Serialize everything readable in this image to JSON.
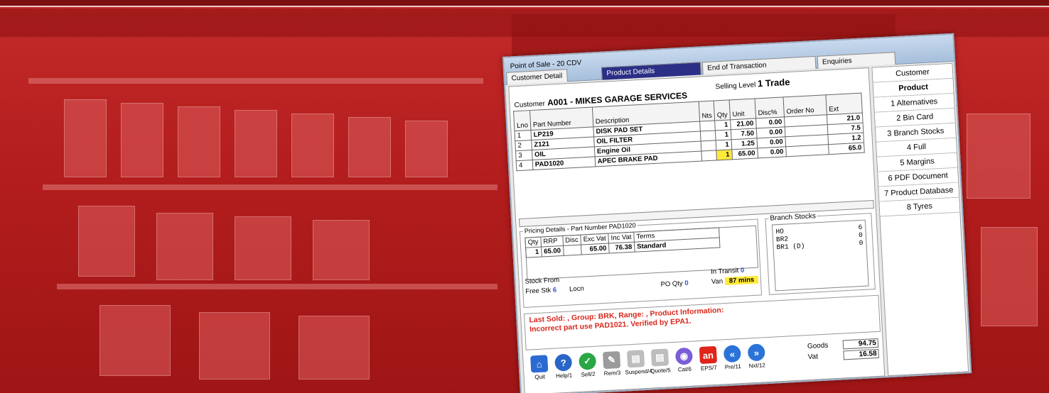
{
  "window": {
    "title": "Point of Sale - 20 CDV"
  },
  "tabs": {
    "t1": "Product Details",
    "t2": "End of Transaction",
    "t3": "Enquiries",
    "customer_detail": "Customer Detail"
  },
  "customer": {
    "label": "Customer",
    "value": "A001 - MIKES GARAGE SERVICES"
  },
  "selling_level": {
    "label": "Selling Level",
    "value": "1 Trade"
  },
  "grid": {
    "headers": [
      "Lno",
      "Part Number",
      "Description",
      "Nts",
      "Qty",
      "Unit",
      "Disc%",
      "Order No",
      "Ext"
    ],
    "rows": [
      {
        "lno": "1",
        "part": "LP219",
        "desc": "DISK PAD SET",
        "qty": "1",
        "unit": "21.00",
        "disc": "0.00",
        "ext": "21.0"
      },
      {
        "lno": "2",
        "part": "Z121",
        "desc": "OIL FILTER",
        "qty": "1",
        "unit": "7.50",
        "disc": "0.00",
        "ext": "7.5"
      },
      {
        "lno": "3",
        "part": "OIL",
        "desc": "Engine Oil",
        "qty": "1",
        "unit": "1.25",
        "disc": "0.00",
        "ext": "1.2"
      },
      {
        "lno": "4",
        "part": "PAD1020",
        "desc": "APEC BRAKE PAD",
        "qty": "1",
        "unit": "65.00",
        "disc": "0.00",
        "ext": "65.0"
      }
    ]
  },
  "pricing": {
    "title": "Pricing Details - Part Number PAD1020",
    "headers": [
      "Qty",
      "RRP",
      "Disc",
      "Exc Vat",
      "Inc Vat",
      "Terms"
    ],
    "row": [
      "1",
      "65.00",
      "",
      "65.00",
      "76.38",
      "Standard"
    ]
  },
  "stock": {
    "from_label": "Stock From",
    "free_label": "Free Stk",
    "free_value": "6",
    "locn_label": "Locn",
    "po_label": "PO Qty",
    "po_value": "0",
    "transit_label": "In Transit",
    "transit_value": "0",
    "van_label": "Van",
    "van_value": "87 mins"
  },
  "branch_stocks": {
    "title": "Branch Stocks",
    "rows": [
      {
        "name": "HO",
        "qty": "6"
      },
      {
        "name": "BR2",
        "qty": "0"
      },
      {
        "name": "BR1 (D)",
        "qty": "0"
      }
    ]
  },
  "info": {
    "line1": "Last Sold: , Group: BRK, Range: , Product Information:",
    "line2": "Incorrect part use PAD1021. Verified by EPA1."
  },
  "sidebar": {
    "items": [
      "Customer",
      "Product",
      "1 Alternatives",
      "2 Bin Card",
      "3 Branch Stocks",
      "4 Full",
      "5 Margins",
      "6 PDF Document",
      "7 Product Database",
      "8 Tyres"
    ]
  },
  "toolbar": {
    "buttons": [
      {
        "label": "Quit",
        "icon": "door-icon",
        "color": "#2b6bd1"
      },
      {
        "label": "Help/1",
        "icon": "help-icon",
        "color": "#2a66c8"
      },
      {
        "label": "Sell/2",
        "icon": "check-icon",
        "color": "#2aa644"
      },
      {
        "label": "Rem/3",
        "icon": "pencil-icon",
        "color": "#8a8a8a"
      },
      {
        "label": "Suspend/4",
        "icon": "clipboard-icon",
        "color": "#b0b0b0"
      },
      {
        "label": "Quote/5",
        "icon": "clipboard-icon",
        "color": "#b0b0b0"
      },
      {
        "label": "Cat/6",
        "icon": "disc-icon",
        "color": "#7a5ed6"
      },
      {
        "label": "EPS/7",
        "icon": "an-icon",
        "color": "#e0231b"
      },
      {
        "label": "Pre/11",
        "icon": "back-icon",
        "color": "#2b73d6"
      },
      {
        "label": "Nxt/12",
        "icon": "forward-icon",
        "color": "#2b73d6"
      }
    ]
  },
  "totals": {
    "goods_label": "Goods",
    "goods_value": "94.75",
    "vat_label": "Vat",
    "vat_value": "16.58"
  }
}
